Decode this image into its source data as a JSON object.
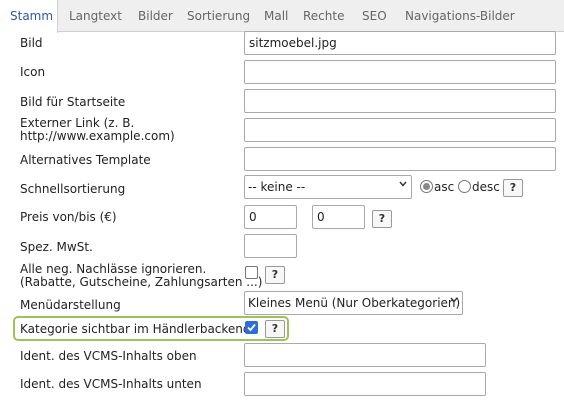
{
  "tabs": [
    {
      "label": "Stamm"
    },
    {
      "label": "Langtext"
    },
    {
      "label": "Bilder"
    },
    {
      "label": "Sortierung"
    },
    {
      "label": "Mall"
    },
    {
      "label": "Rechte"
    },
    {
      "label": "SEO"
    },
    {
      "label": "Navigations-Bilder"
    }
  ],
  "active_tab": "Stamm",
  "form": {
    "bild": {
      "label": "Bild",
      "value": "sitzmoebel.jpg"
    },
    "icon": {
      "label": "Icon",
      "value": ""
    },
    "bild_startseite": {
      "label": "Bild für Startseite",
      "value": ""
    },
    "externer_link": {
      "label_line1": "Externer Link (z. B.",
      "label_line2": "http://www.example.com)",
      "value": ""
    },
    "alt_template": {
      "label": "Alternatives Template",
      "value": ""
    },
    "schnellsortierung": {
      "label": "Schnellsortierung",
      "selected": "-- keine --",
      "asc_label": "asc",
      "desc_label": "desc",
      "asc_checked": true,
      "desc_checked": false
    },
    "preis": {
      "label": "Preis von/bis (€)",
      "from": "0",
      "to": "0"
    },
    "mwst": {
      "label": "Spez. MwSt.",
      "value": ""
    },
    "nachlaesse": {
      "label_line1": "Alle neg. Nachlässe ignorieren.",
      "label_line2": "(Rabatte, Gutscheine, Zahlungsarten ...)",
      "checked": false
    },
    "menuedarstellung": {
      "label": "Menüdarstellung",
      "selected": "Kleines Menü (Nur Oberkategorien)"
    },
    "kategorie_sichtbar": {
      "label": "Kategorie sichtbar im Händlerbackend",
      "checked": true
    },
    "vcms_oben": {
      "label": "Ident. des VCMS-Inhalts oben",
      "value": ""
    },
    "vcms_unten": {
      "label": "Ident. des VCMS-Inhalts unten",
      "value": ""
    }
  },
  "help_glyph": "?",
  "colors": {
    "accent": "#2c5aa0",
    "highlight_border": "#9bc25b",
    "checkbox_checked": "#2b6fd6"
  }
}
